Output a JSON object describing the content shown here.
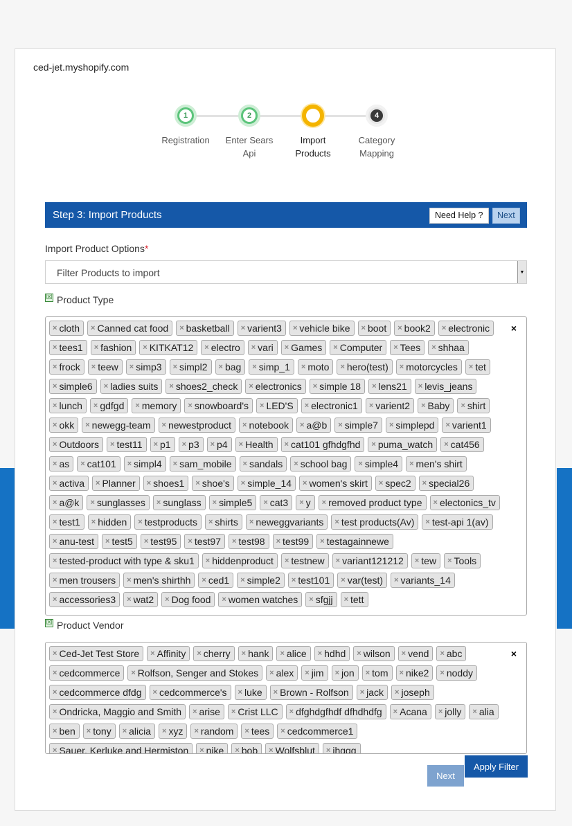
{
  "shop_domain": "ced-jet.myshopify.com",
  "colors": {
    "primary": "#1558a8",
    "step_done": "#5cc47b",
    "step_active": "#f4b400",
    "required": "#d9232d"
  },
  "stepper": {
    "steps": [
      {
        "num": "1",
        "label_line1": "Registration",
        "label_line2": "",
        "state": "done"
      },
      {
        "num": "2",
        "label_line1": "Enter Sears",
        "label_line2": "Api",
        "state": "done"
      },
      {
        "num": "3",
        "label_line1": "Import",
        "label_line2": "Products",
        "state": "active"
      },
      {
        "num": "4",
        "label_line1": "Category",
        "label_line2": "Mapping",
        "state": "todo"
      }
    ]
  },
  "panel": {
    "title": "Step 3: Import Products",
    "help_label": "Need Help ?",
    "next_label": "Next"
  },
  "import_options": {
    "label": "Import Product Options",
    "required_mark": "*",
    "selected": "Filter Products to import"
  },
  "product_type": {
    "label": "Product Type",
    "checked": true,
    "tags": [
      "cloth",
      "Canned cat food",
      "basketball",
      "varient3",
      "vehicle bike",
      "boot",
      "book2",
      "electronic",
      "tees1",
      "fashion",
      "KITKAT12",
      "electro",
      "vari",
      "Games",
      "Computer",
      "Tees",
      "shhaa",
      "frock",
      "teew",
      "simp3",
      "simpl2",
      "bag",
      "simp_1",
      "moto",
      "hero(test)",
      "motorcycles",
      "tet",
      "simple6",
      "ladies suits",
      "shoes2_check",
      "electronics",
      "simple 18",
      "lens21",
      "levis_jeans",
      "lunch",
      "gdfgd",
      "memory",
      "snowboard's",
      "LED'S",
      "electronic1",
      "varient2",
      "Baby",
      "shirt",
      "okk",
      "newegg-team",
      "newestproduct",
      "notebook",
      "a@b",
      "simple7",
      "simplepd",
      "varient1",
      "Outdoors",
      "test11",
      "p1",
      "p3",
      "p4",
      "Health",
      "cat101 gfhdgfhd",
      "puma_watch",
      "cat456",
      "as",
      "cat101",
      "simpl4",
      "sam_mobile",
      "sandals",
      "school bag",
      "simple4",
      "men's shirt",
      "activa",
      "Planner",
      "shoes1",
      "shoe's",
      "simple_14",
      "women's skirt",
      "spec2",
      "special26",
      "a@k",
      "sunglasses",
      "sunglass",
      "simple5",
      "cat3",
      "y",
      "removed product type",
      "electonics_tv",
      "test1",
      "hidden",
      "testproducts",
      "shirts",
      "neweggvariants",
      "test products(Av)",
      "test-api 1(av)",
      "anu-test",
      "test5",
      "test95",
      "test97",
      "test98",
      "test99",
      "testagainnewe",
      "tested-product with type & sku1",
      "hiddenproduct",
      "testnew",
      "variant121212",
      "tew",
      "Tools",
      "men trousers",
      "men's shirthh",
      "ced1",
      "simple2",
      "test101",
      "var(test)",
      "variants_14",
      "accessories3",
      "wat2",
      "Dog food",
      "women watches",
      "sfgjj",
      "tett"
    ]
  },
  "product_vendor": {
    "label": "Product Vendor",
    "checked": true,
    "tags": [
      "Ced-Jet Test Store",
      "Affinity",
      "cherry",
      "hank",
      "alice",
      "hdhd",
      "wilson",
      "vend",
      "abc",
      "cedcommerce",
      "Rolfson, Senger and Stokes",
      "alex",
      "jim",
      "jon",
      "tom",
      "nike2",
      "noddy",
      "cedcommerce dfdg",
      "cedcommerce's",
      "luke",
      "Brown - Rolfson",
      "jack",
      "joseph",
      "Ondricka, Maggio and Smith",
      "arise",
      "Crist LLC",
      "dfghdgfhdf dfhdhdfg",
      "Acana",
      "jolly",
      "alia",
      "ben",
      "tony",
      "alicia",
      "xyz",
      "random",
      "tees",
      "cedcommerce1",
      "Sauer, Kerluke and Hermiston",
      "nike",
      "bob",
      "Wolfsblut",
      "jhggg"
    ]
  },
  "buttons": {
    "next": "Next",
    "apply_filter": "Apply Filter"
  },
  "icons": {
    "tag_remove": "×",
    "clear_all": "×",
    "checkbox": "☒",
    "select_arrow": "▼"
  }
}
